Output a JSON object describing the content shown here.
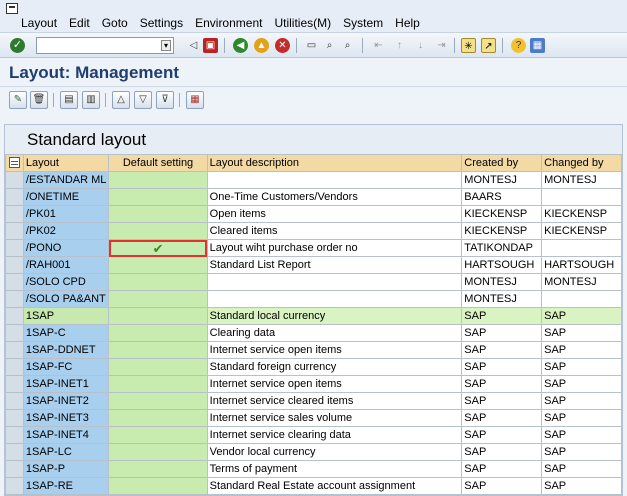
{
  "menu": {
    "items": [
      "Layout",
      "Edit",
      "Goto",
      "Settings",
      "Environment",
      "Utilities(M)",
      "System",
      "Help"
    ]
  },
  "toolbar": {
    "command_value": "",
    "icons": [
      "enter-icon",
      "back-icon",
      "save-icon",
      "green-back-icon",
      "exit-icon",
      "cancel-icon",
      "print-icon",
      "find-icon",
      "find-next-icon",
      "first-page-icon",
      "previous-page-icon",
      "next-page-icon",
      "last-page-icon",
      "create-session-icon",
      "shortcut-icon",
      "help-icon",
      "customize-layout-icon"
    ]
  },
  "page": {
    "title": "Layout: Management"
  },
  "app_toolbar": {
    "icons": [
      "select-layout-icon",
      "delete-icon",
      "export-icon",
      "import-icon",
      "sort-ascending-icon",
      "filter-icon",
      "set-filter-icon",
      "grid-settings-icon"
    ]
  },
  "panel": {
    "title": "Standard layout"
  },
  "table": {
    "headers": [
      "Layout",
      "Default setting",
      "Layout description",
      "Created by",
      "Changed by"
    ],
    "selected_default_row": 4,
    "highlighted_row": 8,
    "rows": [
      [
        "/ESTANDAR ML",
        "",
        "",
        "MONTESJ",
        "MONTESJ"
      ],
      [
        "/ONETIME",
        "",
        "One-Time Customers/Vendors",
        "BAARS",
        ""
      ],
      [
        "/PK01",
        "",
        "Open items",
        "KIECKENSP",
        "KIECKENSP"
      ],
      [
        "/PK02",
        "",
        "Cleared items",
        "KIECKENSP",
        "KIECKENSP"
      ],
      [
        "/PONO",
        "✔",
        "Layout wiht purchase order no",
        "TATIKONDAP",
        ""
      ],
      [
        "/RAH001",
        "",
        "Standard List Report",
        "HARTSOUGH",
        "HARTSOUGH"
      ],
      [
        "/SOLO CPD",
        "",
        "",
        "MONTESJ",
        "MONTESJ"
      ],
      [
        "/SOLO PA&ANT",
        "",
        "",
        "MONTESJ",
        ""
      ],
      [
        "1SAP",
        "",
        "Standard local currency",
        "SAP",
        "SAP"
      ],
      [
        "1SAP-C",
        "",
        "Clearing data",
        "SAP",
        "SAP"
      ],
      [
        "1SAP-DDNET",
        "",
        "Internet service open items",
        "SAP",
        "SAP"
      ],
      [
        "1SAP-FC",
        "",
        "Standard foreign currency",
        "SAP",
        "SAP"
      ],
      [
        "1SAP-INET1",
        "",
        "Internet service open items",
        "SAP",
        "SAP"
      ],
      [
        "1SAP-INET2",
        "",
        "Internet service cleared items",
        "SAP",
        "SAP"
      ],
      [
        "1SAP-INET3",
        "",
        "Internet service sales volume",
        "SAP",
        "SAP"
      ],
      [
        "1SAP-INET4",
        "",
        "Internet service clearing data",
        "SAP",
        "SAP"
      ],
      [
        "1SAP-LC",
        "",
        "Vendor local currency",
        "SAP",
        "SAP"
      ],
      [
        "1SAP-P",
        "",
        "Terms of payment",
        "SAP",
        "SAP"
      ],
      [
        "1SAP-RE",
        "",
        "Standard Real Estate account assignment",
        "SAP",
        "SAP"
      ]
    ]
  }
}
